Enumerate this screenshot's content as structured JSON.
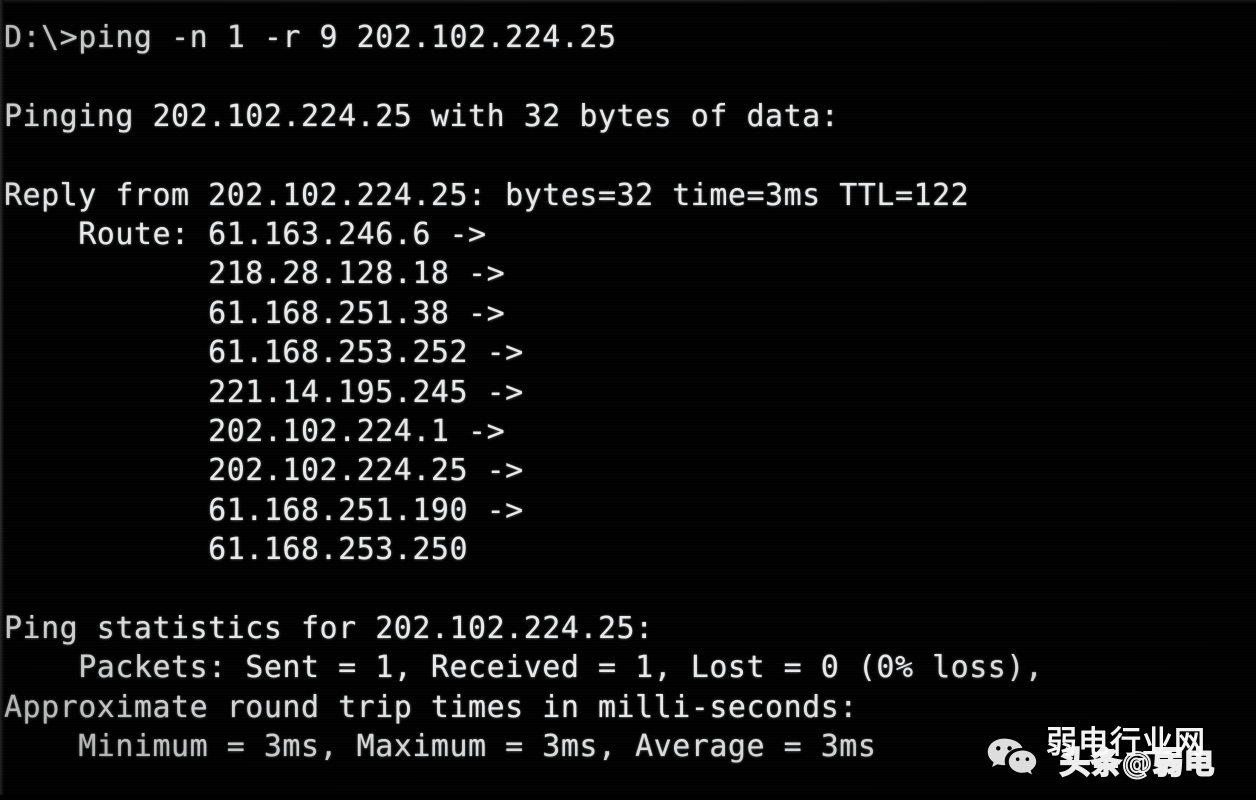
{
  "window": {
    "title": "Command Prompt",
    "background_color": "#000000",
    "text_color": "#e9e9e9"
  },
  "console": {
    "prompt": "D:\\>",
    "command": "ping -n 1 -r 9 202.102.224.25",
    "lines": [
      "D:\\>ping -n 1 -r 9 202.102.224.25",
      "",
      "Pinging 202.102.224.25 with 32 bytes of data:",
      "",
      "Reply from 202.102.224.25: bytes=32 time=3ms TTL=122",
      "    Route: 61.163.246.6 ->",
      "           218.28.128.18 ->",
      "           61.168.251.38 ->",
      "           61.168.253.252 ->",
      "           221.14.195.245 ->",
      "           202.102.224.1 ->",
      "           202.102.224.25 ->",
      "           61.168.251.190 ->",
      "           61.168.253.250",
      "",
      "Ping statistics for 202.102.224.25:",
      "    Packets: Sent = 1, Received = 1, Lost = 0 (0% loss),",
      "Approximate round trip times in milli-seconds:",
      "    Minimum = 3ms, Maximum = 3ms, Average = 3ms"
    ]
  },
  "ping": {
    "target_host": "202.102.224.25",
    "count_flag": "-n 1",
    "route_flag": "-r 9",
    "payload_bytes": "32",
    "pinging_header": "Pinging 202.102.224.25 with 32 bytes of data:",
    "reply": {
      "from": "202.102.224.25",
      "bytes": "32",
      "time": "3ms",
      "ttl": "122",
      "text": "Reply from 202.102.224.25: bytes=32 time=3ms TTL=122"
    },
    "route": {
      "label": "Route:",
      "arrow": "->",
      "hops": [
        "61.163.246.6",
        "218.28.128.18",
        "61.168.251.38",
        "61.168.253.252",
        "221.14.195.245",
        "202.102.224.1",
        "202.102.224.25",
        "61.168.251.190",
        "61.168.253.250"
      ]
    },
    "statistics": {
      "header": "Ping statistics for 202.102.224.25:",
      "packets_line": "    Packets: Sent = 1, Received = 1, Lost = 0 (0% loss),",
      "sent": "1",
      "received": "1",
      "lost": "0",
      "loss_percent": "0%",
      "rtt_header": "Approximate round trip times in milli-seconds:",
      "rtt_line": "    Minimum = 3ms, Maximum = 3ms, Average = 3ms",
      "minimum": "3ms",
      "maximum": "3ms",
      "average": "3ms"
    }
  },
  "watermark": {
    "logo_icon": "wechat-icon",
    "site_name": "弱电行业网",
    "handle": "头条@弱电"
  }
}
